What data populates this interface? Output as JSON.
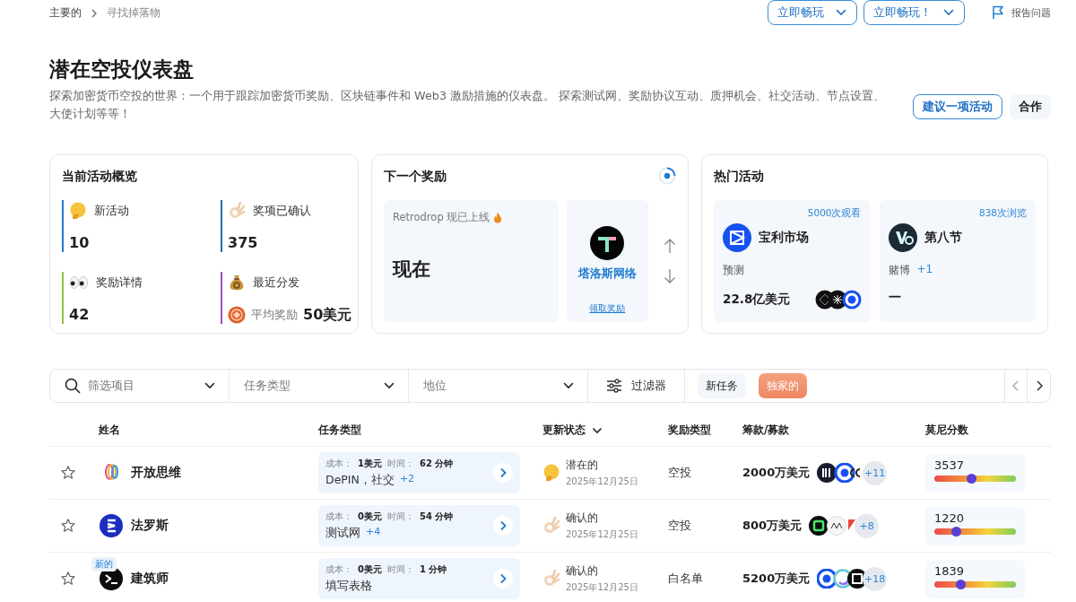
{
  "breadcrumb": [
    {
      "label": "主要的"
    },
    {
      "label": "寻找掉落物"
    }
  ],
  "header_buttons": [
    {
      "label": "立即畅玩"
    },
    {
      "label": "立即畅玩！"
    }
  ],
  "report_link": "报告问题",
  "title": "潜在空投仪表盘",
  "description": "探索加密货币空投的世界：一个用于跟踪加密货币奖励、区块链事件和 Web3 激励措施的仪表盘。 探索测试网、奖励协议互动、质押机会、社交活动、节点设置、大使计划等等！",
  "actions": [
    {
      "label": "建议一项活动",
      "kind": "outline"
    },
    {
      "label": "合作",
      "kind": "soft"
    }
  ],
  "overview": {
    "title": "当前活动概览",
    "stats": [
      {
        "kind": "thinking",
        "label": "新活动",
        "value": "10",
        "color": "#1f7bd0"
      },
      {
        "kind": "ok",
        "label": "奖项已确认",
        "value": "375",
        "color": "#1a6fae"
      },
      {
        "kind": "eyes",
        "label": "奖励详情",
        "value": "42",
        "color": "#8cc63f"
      },
      {
        "kind": "moneybag",
        "label": "最近分发",
        "sublabel": "平均奖励",
        "value": "50美元",
        "color": "#9b4fc2"
      }
    ]
  },
  "next_reward": {
    "title": "下一个奖励",
    "banner": "Retrodrop 现已上线",
    "headline": "现在",
    "project": "塔洛斯网络",
    "link": "领取奖励"
  },
  "trending": {
    "title": "热门活动",
    "items": [
      {
        "views": "5000次观看",
        "name": "宝利市场",
        "category": "预测",
        "amount": "22.8亿美元"
      },
      {
        "views": "838次浏览",
        "name": "第八节",
        "category": "赌博",
        "more": "+1",
        "amount": "一"
      }
    ]
  },
  "filters": [
    {
      "kind": "search",
      "placeholder": "筛选项目"
    },
    {
      "kind": "select",
      "placeholder": "任务类型"
    },
    {
      "kind": "select",
      "placeholder": "地位"
    },
    {
      "kind": "button",
      "label": "过滤器"
    }
  ],
  "chips": [
    {
      "label": "新任务",
      "selected": false
    },
    {
      "label": "独家的",
      "selected": true
    }
  ],
  "columns": [
    {
      "label": "姓名",
      "kind": "plain"
    },
    {
      "label": "任务类型",
      "kind": "plain"
    },
    {
      "label": "更新状态",
      "kind": "sort"
    },
    {
      "label": "奖励类型",
      "kind": "plain"
    },
    {
      "label": "筹款/募款",
      "kind": "plain"
    },
    {
      "label": "莫尼分数",
      "kind": "plain"
    }
  ],
  "rows": [
    {
      "starred": false,
      "name": "开放思维",
      "cost_label": "成本：",
      "cost": "1美元",
      "time_label": "时间：",
      "time": "62 分钟",
      "tags": "DePIN，社交",
      "tags_more": "+2",
      "status": "潜在的",
      "kind": "potential",
      "date": "2025年12月25日",
      "reward": "空投",
      "raised": "2000万美元",
      "investors_more": "+11",
      "score": "3537",
      "level": 0.46
    },
    {
      "starred": false,
      "name": "法罗斯",
      "cost_label": "成本：",
      "cost": "0美元",
      "time_label": "时间：",
      "time": "54 分钟",
      "tags": "测试网",
      "tags_more": "+4",
      "status": "确认的",
      "kind": "confirmed",
      "date": "2025年12月25日",
      "reward": "空投",
      "raised": "800万美元",
      "investors_more": "+8",
      "score": "1220",
      "level": 0.27
    },
    {
      "starred": false,
      "badge": "新的",
      "name": "建筑师",
      "cost_label": "成本：",
      "cost": "0美元",
      "time_label": "时间：",
      "time": "1 分钟",
      "tags": "填写表格",
      "status": "确认的",
      "kind": "confirmed",
      "date": "2025年12月25日",
      "reward": "白名单",
      "raised": "5200万美元",
      "investors_more": "+18",
      "score": "1839",
      "level": 0.32
    }
  ]
}
